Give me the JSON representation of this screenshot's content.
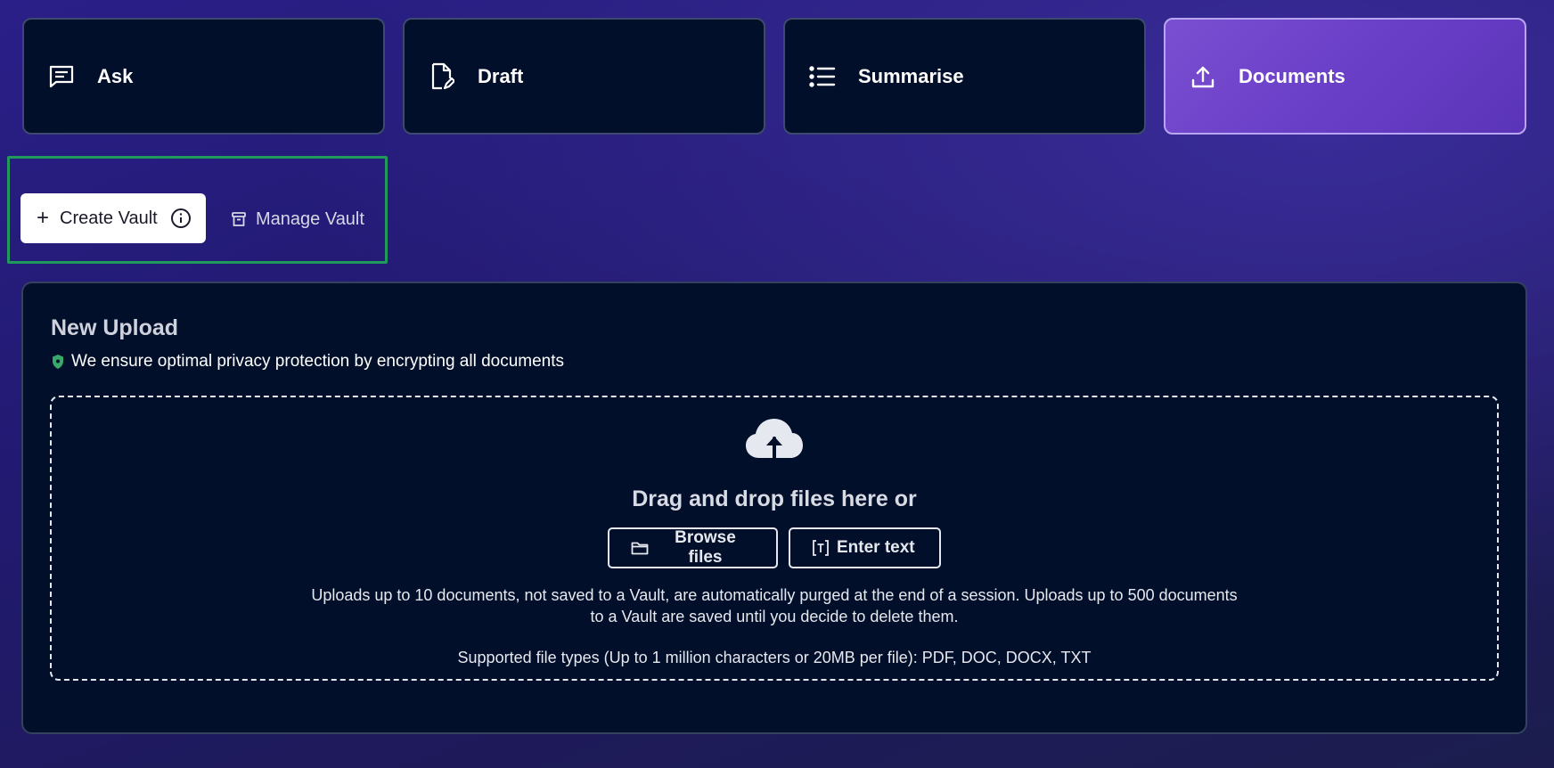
{
  "tabs": [
    {
      "label": "Ask",
      "icon": "chat-icon",
      "active": false
    },
    {
      "label": "Draft",
      "icon": "draft-document-icon",
      "active": false
    },
    {
      "label": "Summarise",
      "icon": "list-icon",
      "active": false
    },
    {
      "label": "Documents",
      "icon": "upload-icon",
      "active": true
    }
  ],
  "vault": {
    "create_label": "Create Vault",
    "manage_label": "Manage Vault"
  },
  "upload": {
    "title": "New Upload",
    "privacy_note": "We ensure optimal privacy protection by encrypting all documents",
    "drag_text": "Drag and drop files here or",
    "browse_label": "Browse files",
    "enter_text_label": "Enter text",
    "limits_note": "Uploads up to 10 documents, not saved to a Vault, are automatically purged at the end of a session. Uploads up to 500 documents to a Vault are saved until you decide to delete them.",
    "supported_types": "Supported file types (Up to 1 million characters or 20MB per file): PDF, DOC, DOCX, TXT"
  },
  "colors": {
    "accent_purple": "#6a3fc8",
    "panel_bg": "#020f2a",
    "highlight_green": "#1f9a5a",
    "shield_green": "#3aa86b"
  }
}
